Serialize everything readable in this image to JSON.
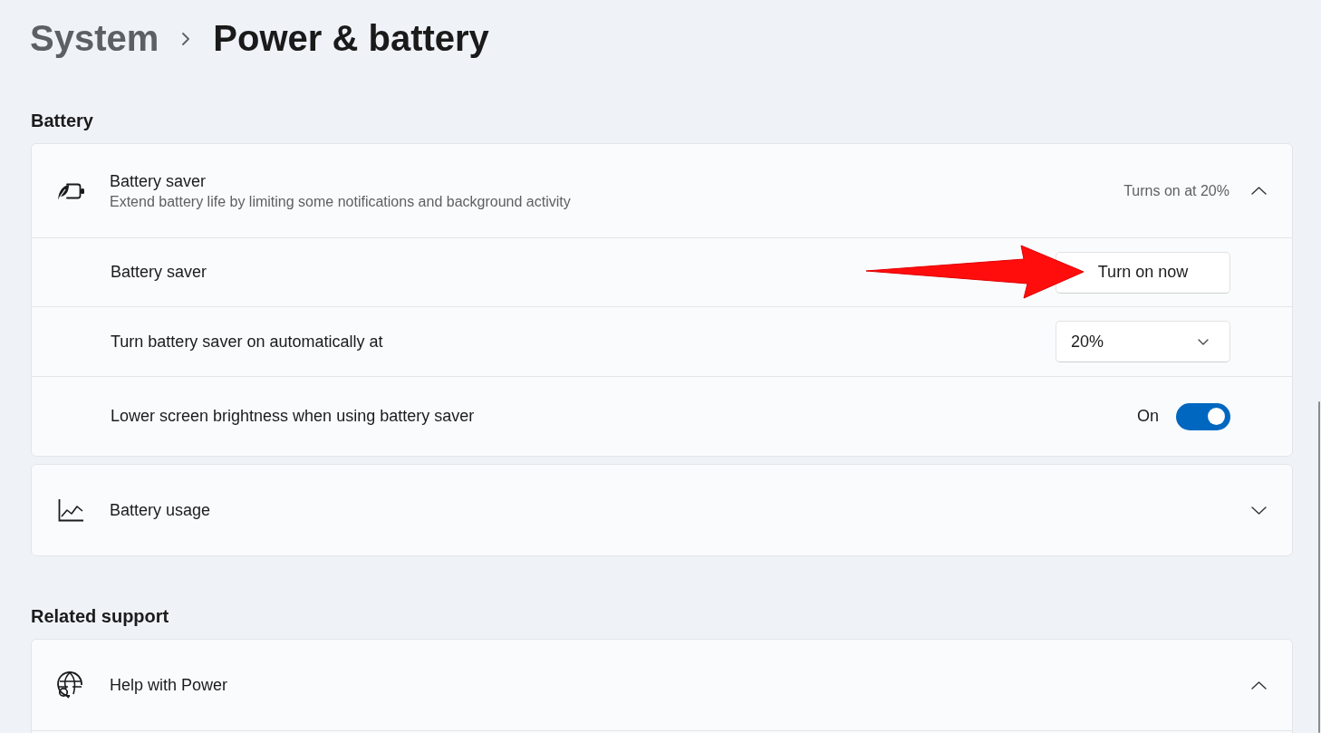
{
  "breadcrumb": [
    {
      "label": "System",
      "selected": false
    },
    {
      "label": "Power & battery",
      "selected": true
    }
  ],
  "sections": [
    {
      "heading": "Battery",
      "cards": [
        {
          "title": "Battery saver",
          "description": "Extend battery life by limiting some notifications and background activity",
          "status": "Turns on at 20%",
          "expanded": true,
          "rows": [
            {
              "kind": "button",
              "label": "Battery saver",
              "button": "Turn on now",
              "annotated": true
            },
            {
              "kind": "dropdown",
              "label": "Turn battery saver on automatically at",
              "value": "20%",
              "annotated": false
            },
            {
              "kind": "toggle",
              "label": "Lower screen brightness when using battery saver",
              "state_label": "On",
              "on": true,
              "annotated": false
            }
          ]
        },
        {
          "title": "Battery usage",
          "expanded": false
        }
      ]
    },
    {
      "heading": "Related support",
      "cards": [
        {
          "title": "Help with Power",
          "expanded": true
        }
      ]
    }
  ]
}
